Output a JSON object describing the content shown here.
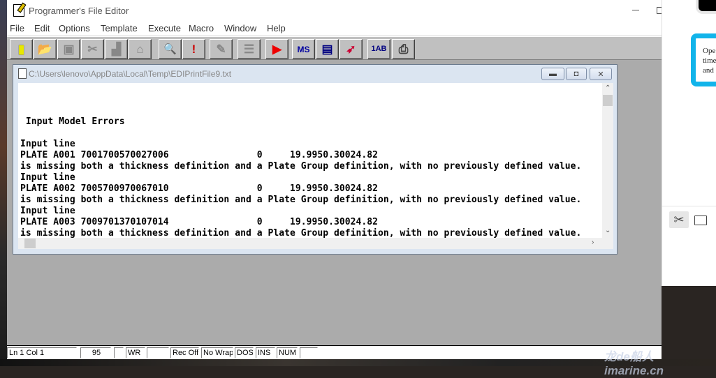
{
  "app": {
    "title": "Programmer's File Editor"
  },
  "menu": [
    "File",
    "Edit",
    "Options",
    "Template",
    "Execute",
    "Macro",
    "Window",
    "Help"
  ],
  "toolbar": [
    {
      "name": "new-file",
      "glyph": "▮"
    },
    {
      "name": "open-file",
      "glyph": "📂"
    },
    {
      "name": "save-file",
      "glyph": "▣"
    },
    {
      "name": "cut",
      "glyph": "✂"
    },
    {
      "name": "copy",
      "glyph": "▟"
    },
    {
      "name": "paste",
      "glyph": "⌂"
    },
    {
      "name": "find",
      "glyph": "🔍"
    },
    {
      "name": "find-next",
      "glyph": "!"
    },
    {
      "name": "edit-pen",
      "glyph": "✎"
    },
    {
      "name": "clipboard",
      "glyph": "☰"
    },
    {
      "name": "macro-record",
      "glyph": "▶"
    },
    {
      "name": "ms-dos",
      "glyph": "MS"
    },
    {
      "name": "window-list",
      "glyph": "▤"
    },
    {
      "name": "execute-rocket",
      "glyph": "➶"
    },
    {
      "name": "case-convert",
      "glyph": "1AB"
    },
    {
      "name": "print",
      "glyph": "⎙"
    }
  ],
  "document": {
    "path": "C:\\Users\\lenovo\\AppData\\Local\\Temp\\EDIPrintFile9.txt",
    "lines": [
      "",
      "",
      "",
      " Input Model Errors",
      "",
      "Input line",
      "PLATE A001 7001700570027006                0     19.9950.30024.82",
      "is missing both a thickness definition and a Plate Group definition, with no previously defined value.",
      "Input line",
      "PLATE A002 7005700970067010                0     19.9950.30024.82",
      "is missing both a thickness definition and a Plate Group definition, with no previously defined value.",
      "Input line",
      "PLATE A003 7009701370107014                0     19.9950.30024.82",
      "is missing both a thickness definition and a Plate Group definition, with no previously defined value."
    ]
  },
  "status": {
    "position": "Ln 1 Col 1",
    "value": "95",
    "blank1": "",
    "mode": "WR",
    "blank2": "",
    "record": "Rec Off",
    "wrap": "No Wrap",
    "format": "DOS",
    "insert": "INS",
    "numlock": "NUM",
    "blank3": ""
  },
  "side_panel": {
    "card_lines": [
      "Ope",
      "time",
      "and"
    ],
    "accent": "#12b4ea"
  },
  "watermark": "龙de船人 imarine.cn"
}
